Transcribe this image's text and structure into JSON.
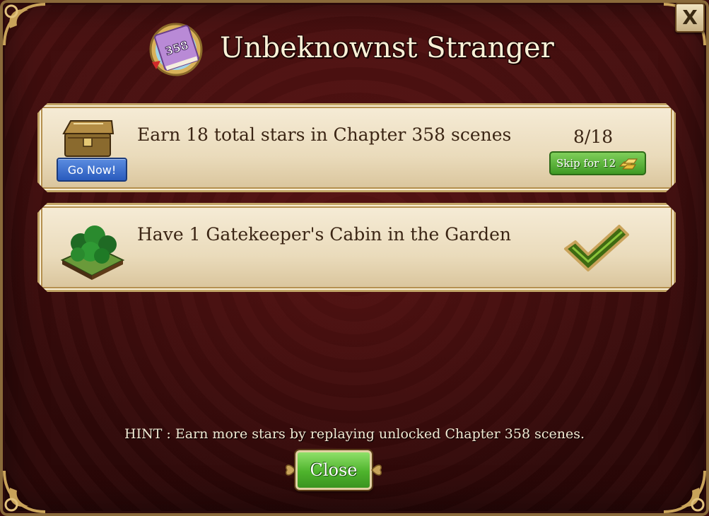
{
  "dialog": {
    "title": "Unbeknownst Stranger",
    "book_badge": "358",
    "close_x_label": "X"
  },
  "tasks": [
    {
      "text": "Earn 18 total stars in Chapter 358 scenes",
      "icon": "treasure-chest-icon",
      "go_label": "Go Now!",
      "progress": "8/18",
      "skip_label": "Skip for 12",
      "skip_currency_icon": "gold-bars-icon",
      "completed": false
    },
    {
      "text": "Have 1 Gatekeeper's Cabin in the Garden",
      "icon": "tree-garden-icon",
      "completed": true
    }
  ],
  "footer": {
    "hint": "HINT : Earn more stars by replaying unlocked Chapter 358 scenes.",
    "close_label": "Close"
  },
  "colors": {
    "background": "#3a0c0c",
    "card": "#eadbbb",
    "go_button": "#2a5bbd",
    "skip_button": "#3f9a24",
    "close_button": "#4eb32c",
    "text": "#3b2514"
  }
}
